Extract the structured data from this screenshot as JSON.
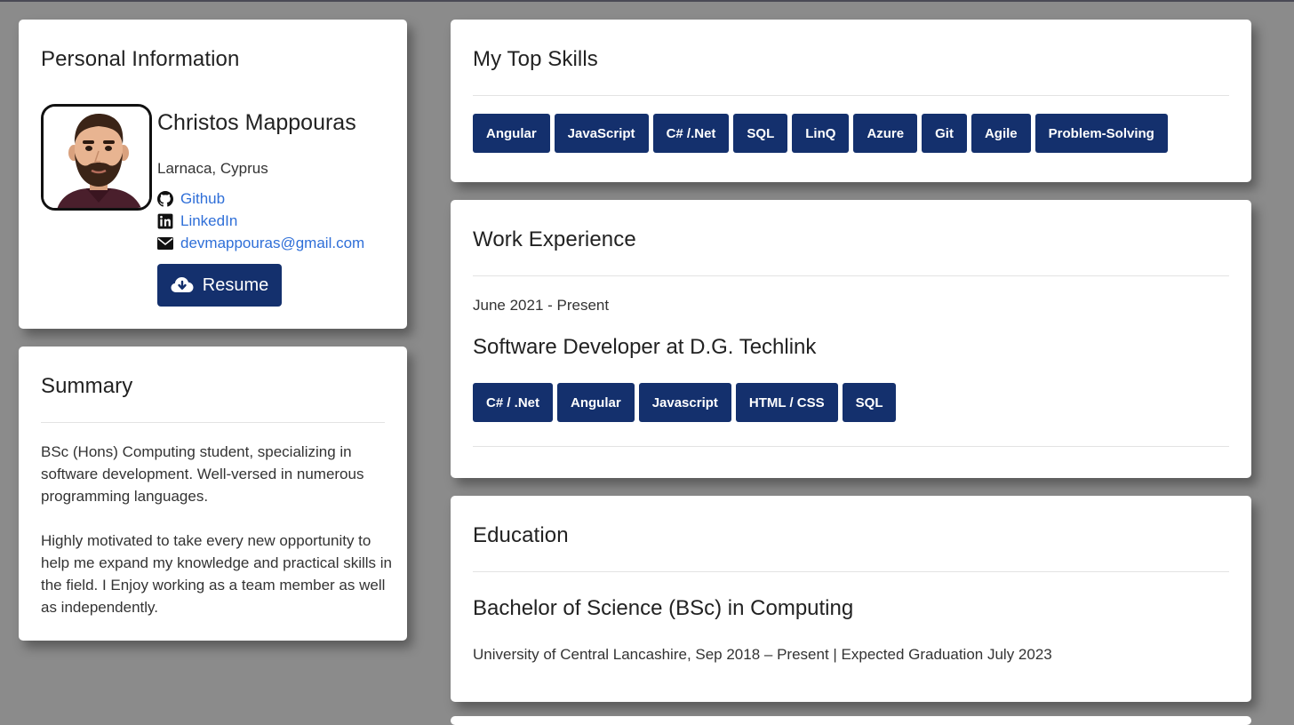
{
  "personal": {
    "heading": "Personal Information",
    "name": "Christos Mappouras",
    "location": "Larnaca, Cyprus",
    "links": [
      {
        "icon": "github-icon",
        "label": "Github"
      },
      {
        "icon": "linkedin-icon",
        "label": "LinkedIn"
      },
      {
        "icon": "envelope-icon",
        "label": "devmappouras@gmail.com"
      }
    ],
    "resume_label": "Resume"
  },
  "summary": {
    "heading": "Summary",
    "paragraphs": [
      "BSc (Hons) Computing student, specializing in software development. Well-versed in numerous programming languages.",
      "Highly motivated to take every new opportunity to help me expand my knowledge and practical skills in the field. I Enjoy working as a team member as well as independently."
    ]
  },
  "skills": {
    "heading": "My Top Skills",
    "items": [
      "Angular",
      "JavaScript",
      "C# /.Net",
      "SQL",
      "LinQ",
      "Azure",
      "Git",
      "Agile",
      "Problem-Solving"
    ]
  },
  "work": {
    "heading": "Work Experience",
    "date": "June 2021 - Present",
    "title": "Software Developer at D.G. Techlink",
    "tags": [
      "C# / .Net",
      "Angular",
      "Javascript",
      "HTML / CSS",
      "SQL"
    ]
  },
  "education": {
    "heading": "Education",
    "degree": "Bachelor of Science (BSc) in Computing",
    "details": "University of Central Lancashire, Sep 2018 – Present | Expected Graduation July 2023"
  },
  "colors": {
    "background": "#8b8b8b",
    "badge": "#14306d",
    "link": "#2f6fd8"
  }
}
